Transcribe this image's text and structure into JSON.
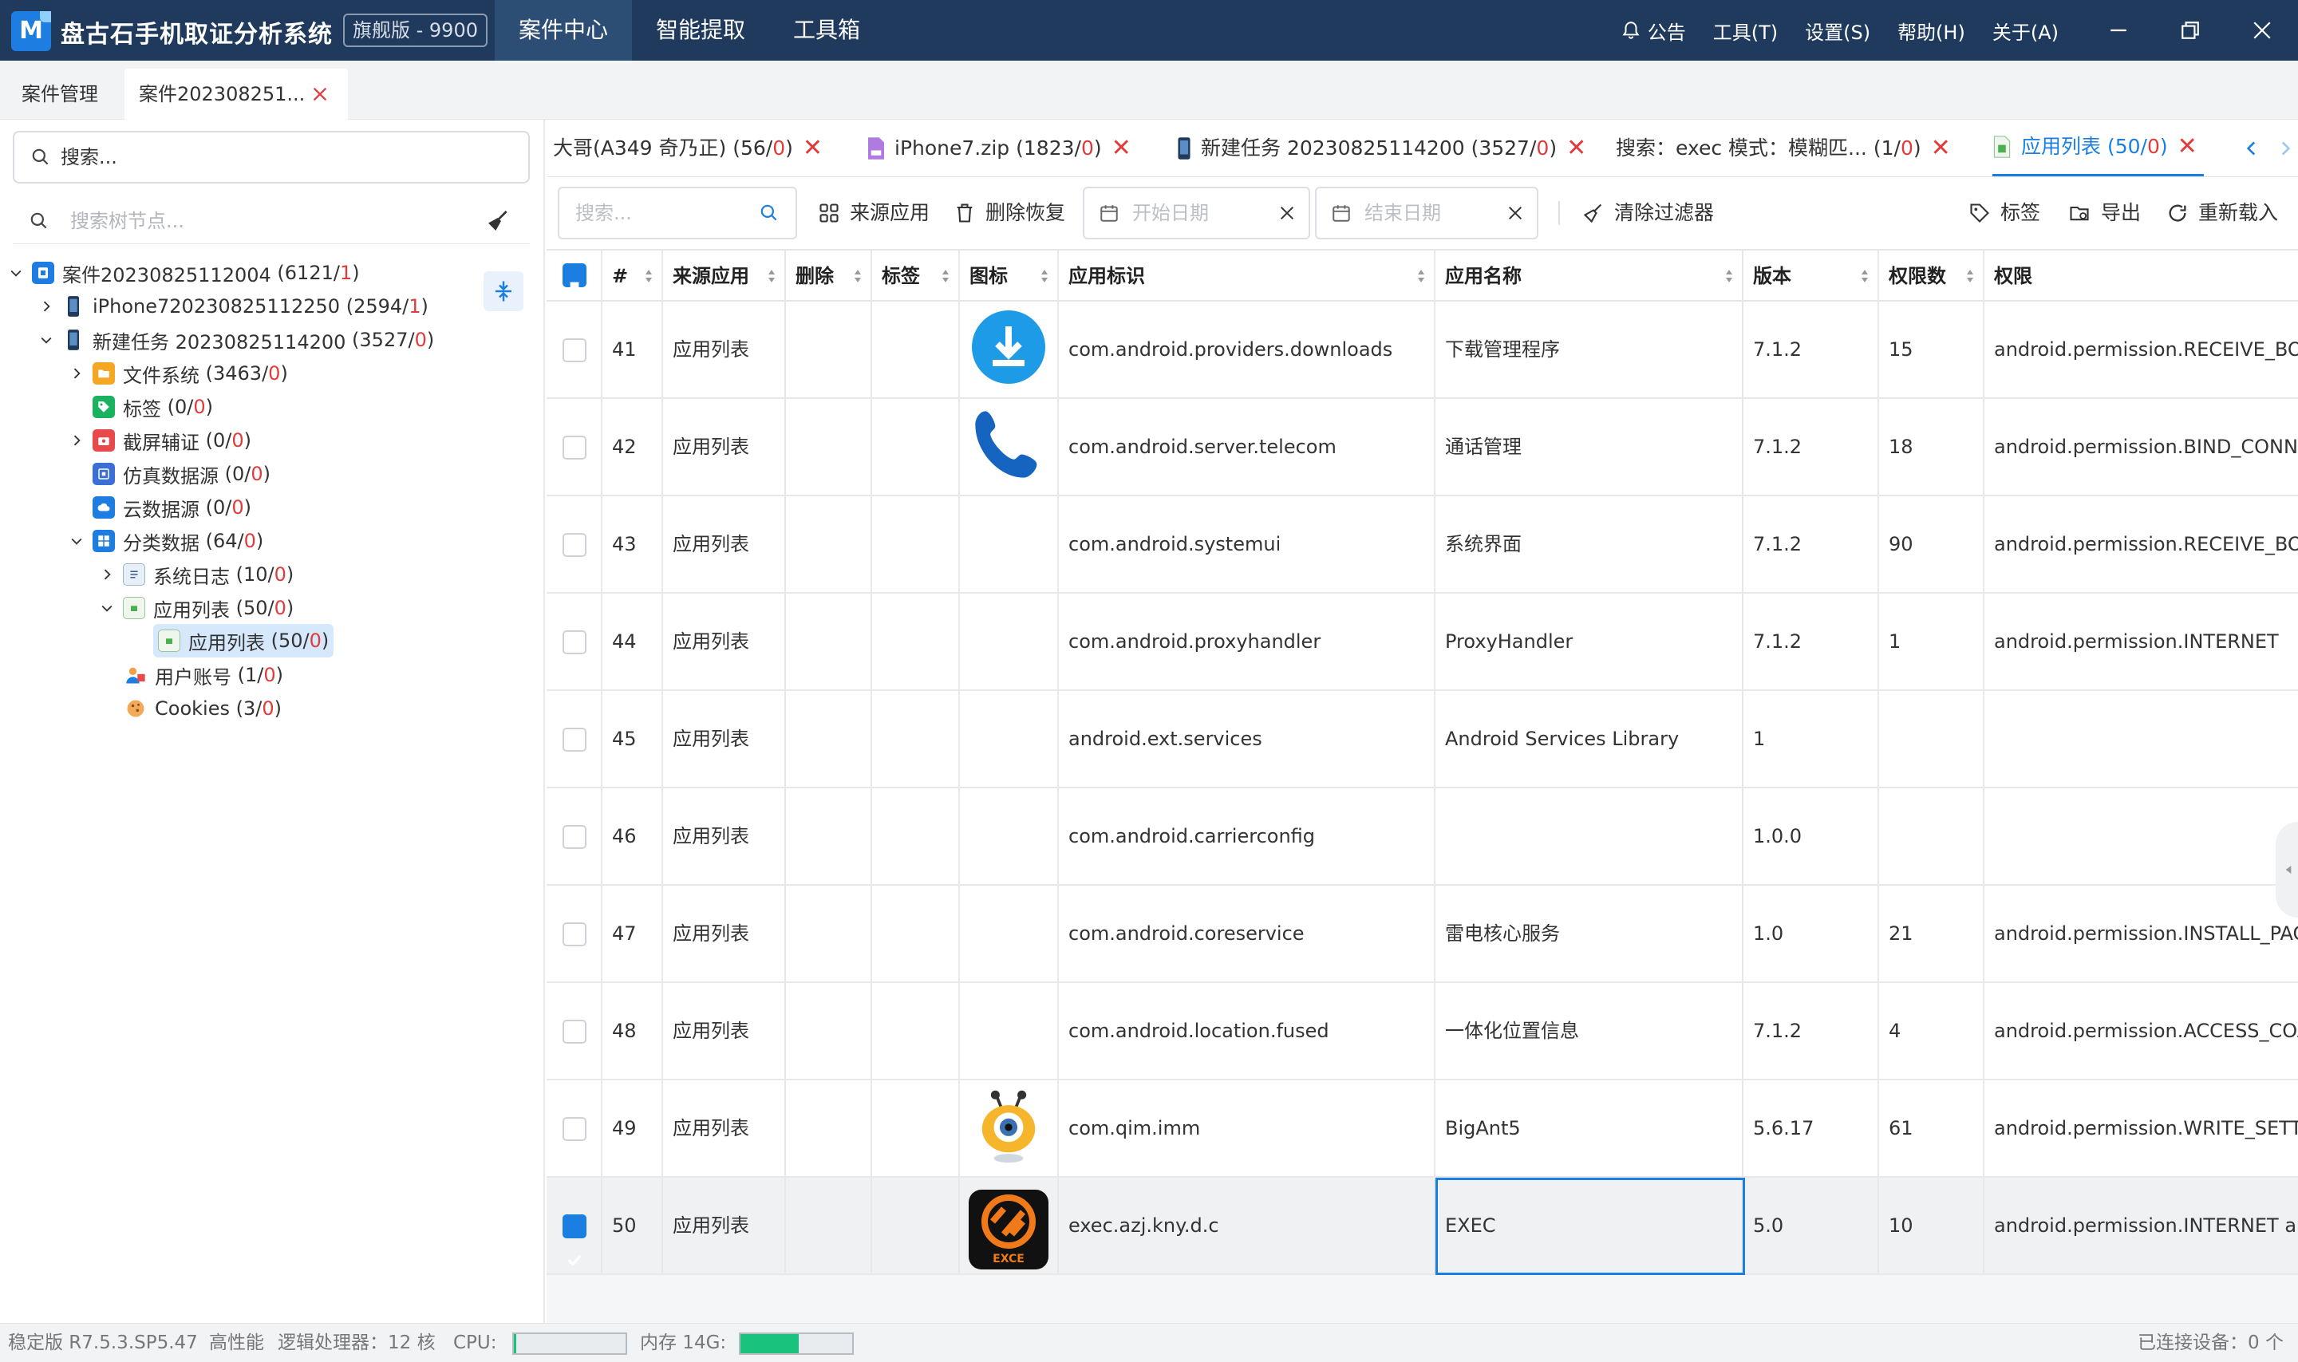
{
  "app": {
    "logo_letter": "M",
    "title": "盘古石手机取证分析系统",
    "edition": "旗舰版 - 9900",
    "nav": [
      "案件中心",
      "智能提取",
      "工具箱"
    ],
    "menu": [
      "公告",
      "工具(T)",
      "设置(S)",
      "帮助(H)",
      "关于(A)"
    ]
  },
  "page_tabs": [
    {
      "label": "案件管理"
    },
    {
      "label": "案件20230825​1...",
      "closable": true
    }
  ],
  "sidebar": {
    "search_placeholder": "搜索...",
    "tree_search_placeholder": "搜索树节点...",
    "tree": [
      {
        "label": "案件20230825112004",
        "count": "6121",
        "red": "1"
      },
      {
        "label": "iPhone720230825112250",
        "count": "2594",
        "red": "1"
      },
      {
        "label": "新建任务 20230825114200",
        "count": "3527",
        "red": "0"
      },
      {
        "label": "文件系统",
        "count": "3463",
        "red": "0"
      },
      {
        "label": "标签",
        "count": "0",
        "red": "0"
      },
      {
        "label": "截屏辅证",
        "count": "0",
        "red": "0"
      },
      {
        "label": "仿真数据源",
        "count": "0",
        "red": "0"
      },
      {
        "label": "云数据源",
        "count": "0",
        "red": "0"
      },
      {
        "label": "分类数据",
        "count": "64",
        "red": "0"
      },
      {
        "label": "系统日志",
        "count": "10",
        "red": "0"
      },
      {
        "label": "应用列表",
        "count": "50",
        "red": "0"
      },
      {
        "label": "应用列表",
        "count": "50",
        "red": "0"
      },
      {
        "label": "用户账号",
        "count": "1",
        "red": "0"
      },
      {
        "label": "Cookies",
        "count": "3",
        "red": "0"
      }
    ]
  },
  "sub_tabs": [
    {
      "label": "大哥(A349 奇乃正)",
      "count": "56",
      "red": "0"
    },
    {
      "label": "iPhone7.zip",
      "count": "1823",
      "red": "0"
    },
    {
      "label": "新建任务 20230825114200",
      "count": "3527",
      "red": "0"
    },
    {
      "label": "搜索：exec  模式：模糊匹...",
      "count": "1",
      "red": "0"
    },
    {
      "label": "应用列表",
      "count": "50",
      "red": "0"
    }
  ],
  "toolbar": {
    "search_placeholder": "搜索...",
    "source_app": "来源应用",
    "delete_recover": "删除恢复",
    "start_date": "开始日期",
    "end_date": "结束日期",
    "clear_filter": "清除过滤器",
    "tag": "标签",
    "export": "导出",
    "reload": "重新载入"
  },
  "table": {
    "columns": [
      "#",
      "来源应用",
      "删除",
      "标签",
      "图标",
      "应用标识",
      "应用名称",
      "版本",
      "权限数",
      "权限"
    ],
    "rows": [
      {
        "n": "41",
        "src": "应用列表",
        "icon": "download",
        "pkg": "com.android.providers.downloads",
        "name": "下载管理程序",
        "ver": "7.1.2",
        "pcount": "15",
        "perm": "android.permission.RECEIVE_BOOT_COMPLETED"
      },
      {
        "n": "42",
        "src": "应用列表",
        "icon": "phone",
        "pkg": "com.android.server.telecom",
        "name": "通话管理",
        "ver": "7.1.2",
        "pcount": "18",
        "perm": "android.permission.BIND_CONNECTION_SERVICE"
      },
      {
        "n": "43",
        "src": "应用列表",
        "icon": "",
        "pkg": "com.android.systemui",
        "name": "系统界面",
        "ver": "7.1.2",
        "pcount": "90",
        "perm": "android.permission.RECEIVE_BOOT_COMPLETED"
      },
      {
        "n": "44",
        "src": "应用列表",
        "icon": "",
        "pkg": "com.android.proxyhandler",
        "name": "ProxyHandler",
        "ver": "7.1.2",
        "pcount": "1",
        "perm": "android.permission.INTERNET"
      },
      {
        "n": "45",
        "src": "应用列表",
        "icon": "",
        "pkg": "android.ext.services",
        "name": "Android Services Library",
        "ver": "1",
        "pcount": "",
        "perm": ""
      },
      {
        "n": "46",
        "src": "应用列表",
        "icon": "",
        "pkg": "com.android.carrierconfig",
        "name": "",
        "ver": "1.0.0",
        "pcount": "",
        "perm": ""
      },
      {
        "n": "47",
        "src": "应用列表",
        "icon": "",
        "pkg": "com.android.coreservice",
        "name": "雷电核心服务",
        "ver": "1.0",
        "pcount": "21",
        "perm": "android.permission.INSTALL_PACKAGES"
      },
      {
        "n": "48",
        "src": "应用列表",
        "icon": "",
        "pkg": "com.android.location.fused",
        "name": "一体化位置信息",
        "ver": "7.1.2",
        "pcount": "4",
        "perm": "android.permission.ACCESS_COARSE_LOCATION"
      },
      {
        "n": "49",
        "src": "应用列表",
        "icon": "bigant",
        "pkg": "com.qim.imm",
        "name": "BigAnt5",
        "ver": "5.6.17",
        "pcount": "61",
        "perm": "android.permission.WRITE_SETTINGS"
      },
      {
        "n": "50",
        "src": "应用列表",
        "icon": "exec",
        "pkg": "exec.azj.kny.d.c",
        "name": "EXEC",
        "ver": "5.0",
        "pcount": "10",
        "perm": "android.permission.INTERNET  android.permission"
      }
    ],
    "exec_icon_caption": "EXCE"
  },
  "status": {
    "version": "稳定版  R7.5.3.SP5.47",
    "perf": "高性能",
    "cpu_label": "逻辑处理器：12 核",
    "cpu_word": "CPU:",
    "cpu_usage": 0.02,
    "mem_label": "内存 14G:",
    "mem_usage": 0.52,
    "devices": "已连接设备：0 个"
  },
  "colors": {
    "titlebar": "#1f3a5c",
    "accent": "#1a7fe0",
    "red": "#e23b3b",
    "mem": "#19c37d"
  }
}
